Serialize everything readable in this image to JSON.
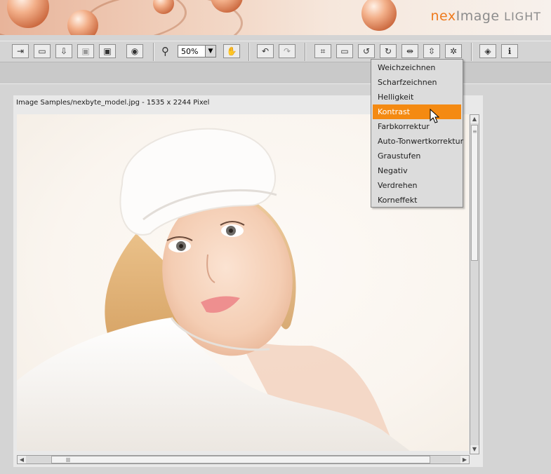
{
  "brand": {
    "part1": "nex",
    "part2": "Image",
    "part3": "LIGHT"
  },
  "toolbar": {
    "buttons": [
      {
        "name": "exit-icon",
        "glyph": "⇥"
      },
      {
        "name": "open-folder-icon",
        "glyph": "▭"
      },
      {
        "name": "import-icon",
        "glyph": "⇩"
      },
      {
        "name": "save-icon",
        "glyph": "▣"
      },
      {
        "name": "save-as-icon",
        "glyph": "▣"
      },
      {
        "name": "preview-eye-icon",
        "glyph": "◉"
      },
      {
        "name": "hand-pan-icon",
        "glyph": "✋"
      },
      {
        "name": "undo-icon",
        "glyph": "↶"
      },
      {
        "name": "redo-icon",
        "glyph": "↷"
      },
      {
        "name": "crop-icon",
        "glyph": "⌗"
      },
      {
        "name": "resize-icon",
        "glyph": "▭"
      },
      {
        "name": "rotate-left-icon",
        "glyph": "↺"
      },
      {
        "name": "rotate-right-icon",
        "glyph": "↻"
      },
      {
        "name": "flip-horizontal-icon",
        "glyph": "⇹"
      },
      {
        "name": "flip-vertical-icon",
        "glyph": "⇳"
      },
      {
        "name": "effects-icon",
        "glyph": "✲"
      },
      {
        "name": "book-icon",
        "glyph": "◈"
      },
      {
        "name": "info-icon",
        "glyph": "ℹ"
      }
    ],
    "zoom": {
      "value": "50%"
    }
  },
  "image_panel": {
    "title": "Image Samples/nexbyte_model.jpg  -  1535 x 2244 Pixel"
  },
  "menu": {
    "items": [
      {
        "label": "Weichzeichnen"
      },
      {
        "label": "Scharfzeichnen"
      },
      {
        "label": "Helligkeit"
      },
      {
        "label": "Kontrast",
        "active": true
      },
      {
        "label": "Farbkorrektur"
      },
      {
        "label": "Auto-Tonwertkorrektur"
      },
      {
        "label": "Graustufen"
      },
      {
        "label": "Negativ"
      },
      {
        "label": "Verdrehen"
      },
      {
        "label": "Korneffekt"
      }
    ]
  },
  "colors": {
    "accent": "#f48a12",
    "logo_orange": "#ee7a1d"
  }
}
